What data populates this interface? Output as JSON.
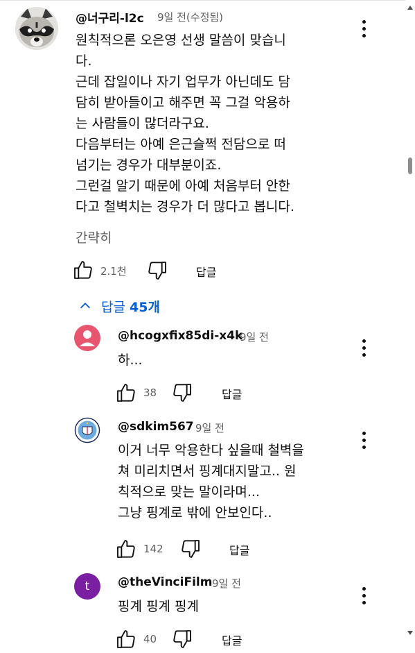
{
  "comments": [
    {
      "handle": "@너구리-l2c",
      "time": "9일 전(수정됨)",
      "avatar": "raccoon",
      "lines": [
        "원칙적으론 오은영 선생 말씀이 맞습니",
        "다.",
        "근데 잡일이나 자기 업무가 아닌데도 담",
        "담히 받아들이고 해주면 꼭 그걸 악용하",
        "는 사람들이 많더라구요.",
        "다음부터는 아예 은근슬쩍 전담으로 떠",
        "넘기는 경우가 대부분이죠.",
        "그런걸 알기 때문에 아예 처음부터 안한",
        "다고 철벽치는 경우가 더 많다고 봅니다."
      ],
      "show_less": "간략히",
      "likes": "2.1천",
      "reply_label": "답글"
    }
  ],
  "replies_toggle": {
    "label": "답글",
    "count": "45개",
    "icon": "chevron-up-icon"
  },
  "replies": [
    {
      "handle": "@hcogxfix85di-x4k",
      "time": "9일 전",
      "avatar": "default-person",
      "avatar_color": "#e8556e",
      "lines": [
        "하..."
      ],
      "likes": "38",
      "reply_label": "답글"
    },
    {
      "handle": "@sdkim567",
      "time": "9일 전",
      "avatar": "club-crest",
      "lines": [
        "이거 너무 악용한다 싶을때 철벽을",
        "쳐 미리치면서 핑계대지말고.. 원",
        "칙적으로 맞는 말이라며...",
        "그냥 핑계로 밖에 안보인다.."
      ],
      "likes": "142",
      "reply_label": "답글"
    },
    {
      "handle": "@theVinciFilm",
      "time": "9일 전",
      "avatar": "letter",
      "avatar_letter": "t",
      "avatar_color": "#7b1fa2",
      "lines": [
        "핑계 핑계 핑계"
      ],
      "likes": "40",
      "reply_label": "답글"
    }
  ],
  "colors": {
    "link_blue": "#065fd4",
    "secondary_text": "#606060",
    "primary_text": "#0f0f0f"
  }
}
